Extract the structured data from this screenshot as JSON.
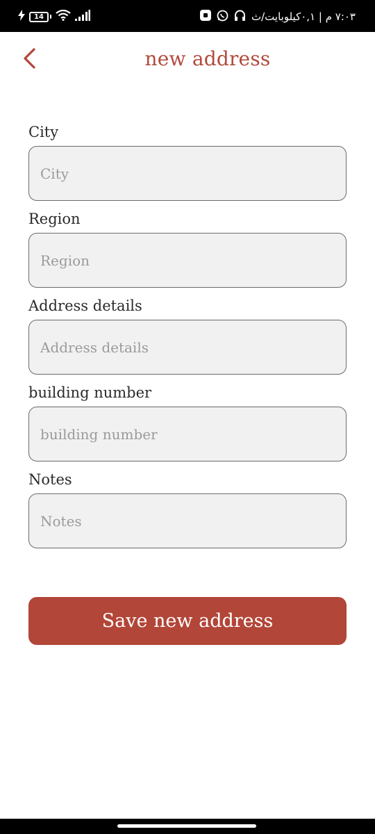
{
  "status_bar": {
    "battery_level": "14",
    "time_text": "٧:٠٣ م | ٠,١كيلوبايت/ث",
    "icons": [
      "charging-bolt-icon",
      "battery-icon",
      "wifi-icon",
      "cellular-signal-icon",
      "app-notification-icon",
      "whatsapp-icon",
      "headphones-icon"
    ]
  },
  "header": {
    "title": "new address",
    "back_icon": "chevron-left-icon"
  },
  "form": {
    "fields": [
      {
        "label": "City",
        "placeholder": "City",
        "value": ""
      },
      {
        "label": "Region",
        "placeholder": "Region",
        "value": ""
      },
      {
        "label": "Address details",
        "placeholder": "Address details",
        "value": ""
      },
      {
        "label": "building number",
        "placeholder": "building number",
        "value": ""
      },
      {
        "label": "Notes",
        "placeholder": "Notes",
        "value": ""
      }
    ],
    "submit_label": "Save new address"
  },
  "colors": {
    "accent": "#b24638",
    "title": "#b24a3c",
    "input_background": "#f1f1f1",
    "input_border": "#6a6a6a",
    "status_bar": "#000000"
  }
}
